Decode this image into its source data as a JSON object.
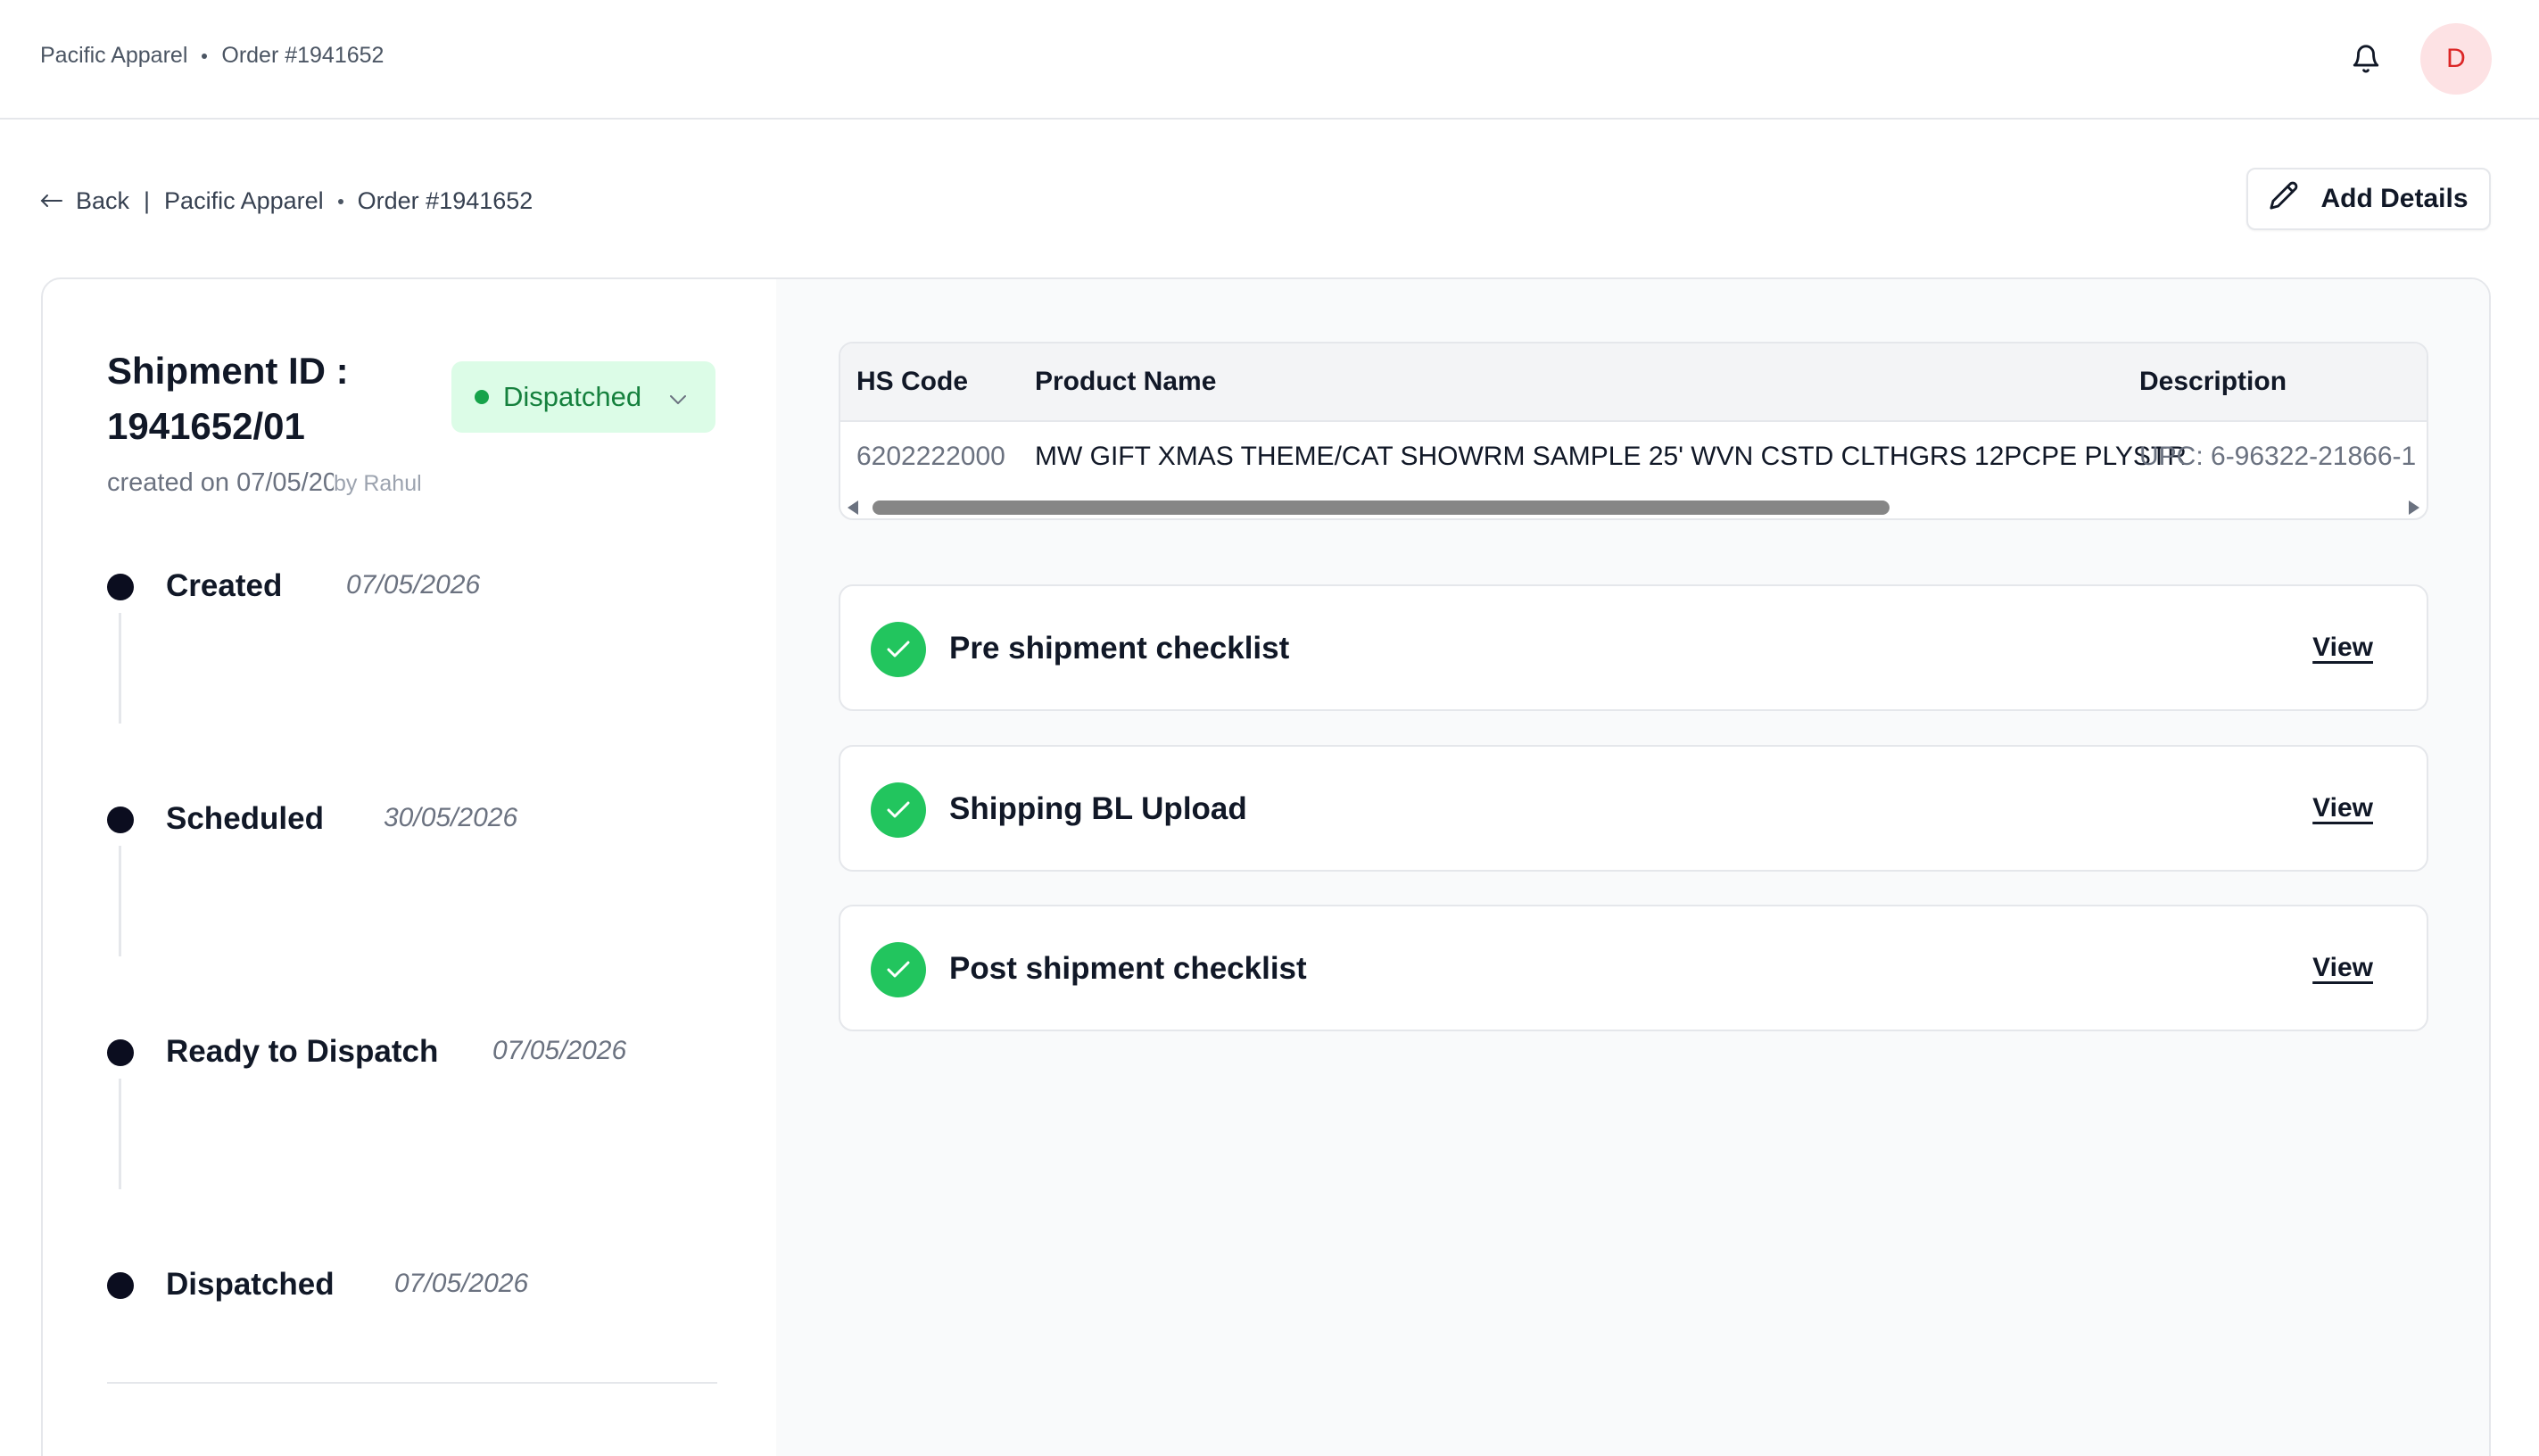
{
  "header": {
    "breadcrumb": [
      "Pacific Apparel",
      "Order #1941652"
    ],
    "bell_icon": "bell-icon",
    "avatar_initial": "D"
  },
  "nav": {
    "back_label": "Back",
    "separator": "|",
    "crumbs": [
      "Pacific Apparel",
      "Order #1941652"
    ],
    "add_details_label": "Add Details",
    "add_details_icon": "pencil-icon"
  },
  "shipment": {
    "title": "Shipment ID : 1941652/01",
    "status": "Dispatched",
    "status_color": "#15803d",
    "created_on": "created on 07/05/2026",
    "created_by": "by Rahul"
  },
  "timeline": [
    {
      "label": "Created",
      "date": "07/05/2026"
    },
    {
      "label": "Scheduled",
      "date": "30/05/2026"
    },
    {
      "label": "Ready to Dispatch",
      "date": "07/05/2026"
    },
    {
      "label": "Dispatched",
      "date": "07/05/2026"
    }
  ],
  "products_table": {
    "columns": [
      "HS Code",
      "Product Name",
      "Description"
    ],
    "rows": [
      [
        "6202222000",
        "MW GIFT XMAS THEME/CAT SHOWRM SAMPLE 25' WVN CSTD CLTHGRS 12PCPE PLYSTR",
        "UPC: 6-96322-21866-1"
      ]
    ]
  },
  "checklists": [
    {
      "label": "Pre shipment checklist",
      "action": "View",
      "status_icon": "check-icon"
    },
    {
      "label": "Shipping BL Upload",
      "action": "View",
      "status_icon": "check-icon"
    },
    {
      "label": "Post shipment checklist",
      "action": "View",
      "status_icon": "check-icon"
    }
  ],
  "colors": {
    "accent_green": "#22c55e",
    "status_bg": "#dcfce7",
    "avatar_bg": "#fde2e4",
    "avatar_text": "#dc2626"
  }
}
